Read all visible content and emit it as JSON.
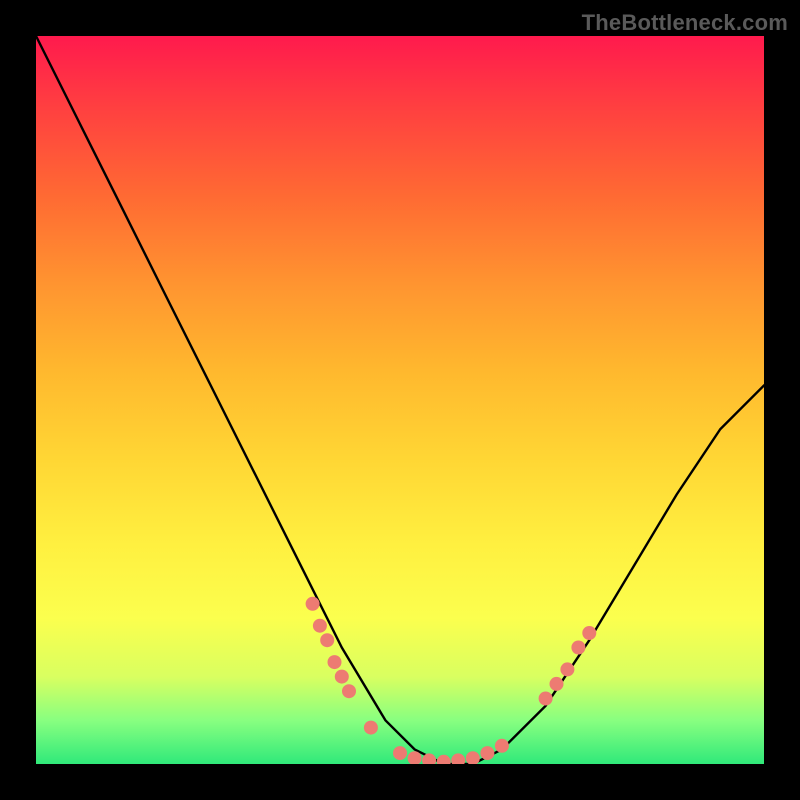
{
  "watermark": "TheBottleneck.com",
  "chart_data": {
    "type": "line",
    "title": "",
    "xlabel": "",
    "ylabel": "",
    "xlim": [
      0,
      100
    ],
    "ylim": [
      0,
      100
    ],
    "grid": false,
    "series": [
      {
        "name": "bottleneck-curve",
        "x": [
          0,
          6,
          12,
          18,
          24,
          30,
          36,
          42,
          48,
          52,
          56,
          60,
          64,
          70,
          76,
          82,
          88,
          94,
          100
        ],
        "y": [
          100,
          88,
          76,
          64,
          52,
          40,
          28,
          16,
          6,
          2,
          0,
          0,
          2,
          8,
          17,
          27,
          37,
          46,
          52
        ]
      }
    ],
    "markers": {
      "name": "highlighted-points",
      "color": "#ed7b72",
      "points": [
        {
          "x": 38,
          "y": 22
        },
        {
          "x": 39,
          "y": 19
        },
        {
          "x": 40,
          "y": 17
        },
        {
          "x": 41,
          "y": 14
        },
        {
          "x": 42,
          "y": 12
        },
        {
          "x": 43,
          "y": 10
        },
        {
          "x": 46,
          "y": 5
        },
        {
          "x": 50,
          "y": 1.5
        },
        {
          "x": 52,
          "y": 0.8
        },
        {
          "x": 54,
          "y": 0.5
        },
        {
          "x": 56,
          "y": 0.3
        },
        {
          "x": 58,
          "y": 0.5
        },
        {
          "x": 60,
          "y": 0.8
        },
        {
          "x": 62,
          "y": 1.5
        },
        {
          "x": 64,
          "y": 2.5
        },
        {
          "x": 70,
          "y": 9
        },
        {
          "x": 71.5,
          "y": 11
        },
        {
          "x": 73,
          "y": 13
        },
        {
          "x": 74.5,
          "y": 16
        },
        {
          "x": 76,
          "y": 18
        }
      ]
    },
    "background_gradient": {
      "top": "#ff1a4d",
      "bottom": "#30e97a"
    }
  }
}
